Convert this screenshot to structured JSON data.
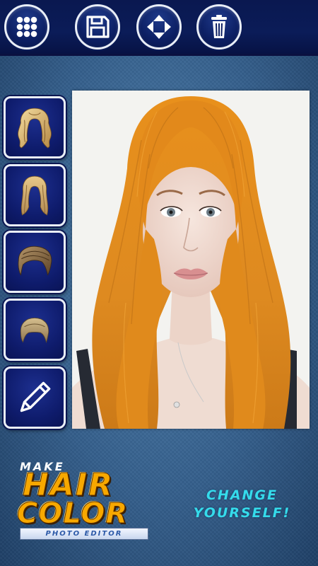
{
  "toolbar": {
    "buttons": [
      {
        "name": "menu",
        "icon": "grid-dots-icon"
      },
      {
        "name": "save",
        "icon": "floppy-disk-icon"
      },
      {
        "name": "move",
        "icon": "move-arrows-icon"
      },
      {
        "name": "delete",
        "icon": "trash-icon"
      }
    ]
  },
  "sidebar": {
    "items": [
      {
        "name": "hairstyle-long-wavy-blonde",
        "icon": "long-wavy-hair-icon"
      },
      {
        "name": "hairstyle-long-straight-blonde",
        "icon": "long-straight-hair-icon"
      },
      {
        "name": "hairstyle-short-swept-brown",
        "icon": "short-swept-hair-icon"
      },
      {
        "name": "hairstyle-short-crop",
        "icon": "short-crop-hair-icon"
      },
      {
        "name": "draw",
        "icon": "pencil-icon"
      }
    ]
  },
  "photo": {
    "description_icon": "portrait-photo",
    "hair_color": "#e58a1c"
  },
  "branding": {
    "make": "MAKE",
    "hair": "HAIR",
    "color": "COLOR",
    "subtitle": "PHOTO EDITOR",
    "tagline_line1": "CHANGE",
    "tagline_line2": "YOURSELF!"
  },
  "colors": {
    "toolbar_bg": "#0b1c58",
    "button_border": "#e9eef7",
    "logo_orange": "#f7a800",
    "tagline_cyan": "#35dbeb"
  }
}
